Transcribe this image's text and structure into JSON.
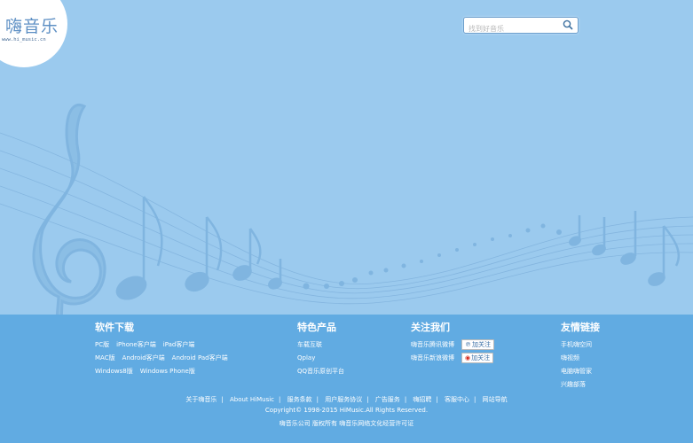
{
  "logo": {
    "title": "嗨音乐",
    "url": "www.hi_music.cn"
  },
  "search": {
    "placeholder": "找到好音乐",
    "icon": "search-icon"
  },
  "footer": {
    "software": {
      "title": "软件下载",
      "rows": [
        [
          "PC版",
          "iPhone客户端",
          "iPad客户端"
        ],
        [
          "MAC版",
          "Android客户端",
          "Android Pad客户端"
        ],
        [
          "Windows8版",
          "Windows Phone版"
        ]
      ]
    },
    "products": {
      "title": "特色产品",
      "items": [
        "车载互联",
        "Qplay",
        "QQ音乐原创平台"
      ]
    },
    "follow": {
      "title": "关注我们",
      "items": [
        {
          "label": "嗨音乐腾讯微博",
          "button": "加关注",
          "icon": "tencent-weibo-icon"
        },
        {
          "label": "嗨音乐新浪微博",
          "button": "加关注",
          "icon": "sina-weibo-icon"
        }
      ]
    },
    "links": {
      "title": "友情链接",
      "items": [
        "手机嗨空间",
        "嗨视频",
        "电脑嗨管家",
        "兴趣部落"
      ]
    },
    "nav": [
      "关于嗨音乐",
      "About HiMusic",
      "服务条款",
      "用户服务协议",
      "广告服务",
      "嗨招聘",
      "客服中心",
      "网站导航"
    ],
    "copyright": "Copyright© 1998-2015 HiMusic.All Rights Reserved.",
    "license": "嗨音乐公司 版权所有 嗨音乐网络文化经营许可证"
  },
  "colors": {
    "background": "#9bcaee",
    "footer": "#61abe2",
    "decoration": "#7fb4e0"
  }
}
